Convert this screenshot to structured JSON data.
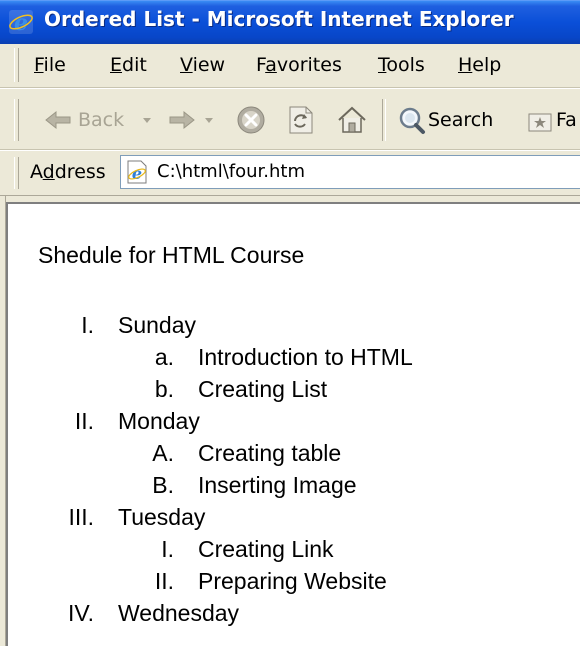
{
  "window": {
    "title": "Ordered List - Microsoft Internet Explorer"
  },
  "menubar": {
    "items": [
      {
        "label": "File",
        "underline": "F",
        "rest": "ile"
      },
      {
        "label": "Edit",
        "underline": "E",
        "rest": "dit"
      },
      {
        "label": "View",
        "underline": "V",
        "rest": "iew"
      },
      {
        "label": "Favorites",
        "pre": "F",
        "underline": "a",
        "rest": "vorites"
      },
      {
        "label": "Tools",
        "underline": "T",
        "rest": "ools"
      },
      {
        "label": "Help",
        "underline": "H",
        "rest": "elp"
      }
    ]
  },
  "toolbar": {
    "back_label": "Back",
    "search_label": "Search",
    "favorites_label": "Fa",
    "icons": [
      "back-arrow-icon",
      "dropdown-icon",
      "forward-arrow-icon",
      "dropdown-icon",
      "stop-icon",
      "refresh-icon",
      "home-icon",
      "search-icon",
      "favorites-icon"
    ]
  },
  "address": {
    "label_pre": "A",
    "label_ul": "d",
    "label_rest": "dress",
    "value": "C:\\html\\four.htm"
  },
  "page": {
    "heading": "Shedule for HTML Course",
    "days": [
      {
        "marker": "I.",
        "label": "Sunday",
        "subs": [
          {
            "marker": "a.",
            "label": "Introduction to HTML"
          },
          {
            "marker": "b.",
            "label": "Creating List"
          }
        ]
      },
      {
        "marker": "II.",
        "label": "Monday",
        "subs": [
          {
            "marker": "A.",
            "label": "Creating table"
          },
          {
            "marker": "B.",
            "label": "Inserting Image"
          }
        ]
      },
      {
        "marker": "III.",
        "label": "Tuesday",
        "subs": [
          {
            "marker": "I.",
            "label": "Creating Link"
          },
          {
            "marker": "II.",
            "label": "Preparing Website"
          }
        ]
      },
      {
        "marker": "IV.",
        "label": "Wednesday",
        "subs": []
      }
    ]
  },
  "colors": {
    "titlebar": "#0a4fd8",
    "chrome": "#ece9d8",
    "content_bg": "#ffffff"
  }
}
